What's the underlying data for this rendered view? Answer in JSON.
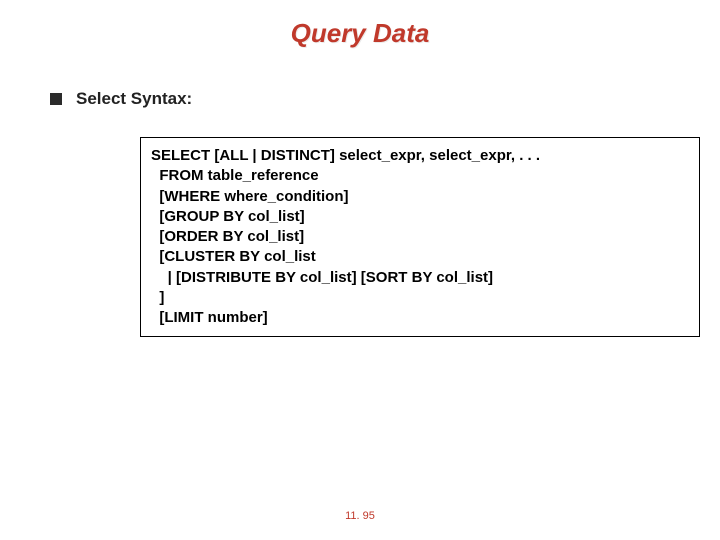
{
  "title": "Query Data",
  "bullet": {
    "label": "Select Syntax:"
  },
  "code": "SELECT [ALL | DISTINCT] select_expr, select_expr, . . .\n  FROM table_reference\n  [WHERE where_condition]\n  [GROUP BY col_list]\n  [ORDER BY col_list]\n  [CLUSTER BY col_list\n    | [DISTRIBUTE BY col_list] [SORT BY col_list]\n  ]\n  [LIMIT number]",
  "page_number": "11. 95"
}
